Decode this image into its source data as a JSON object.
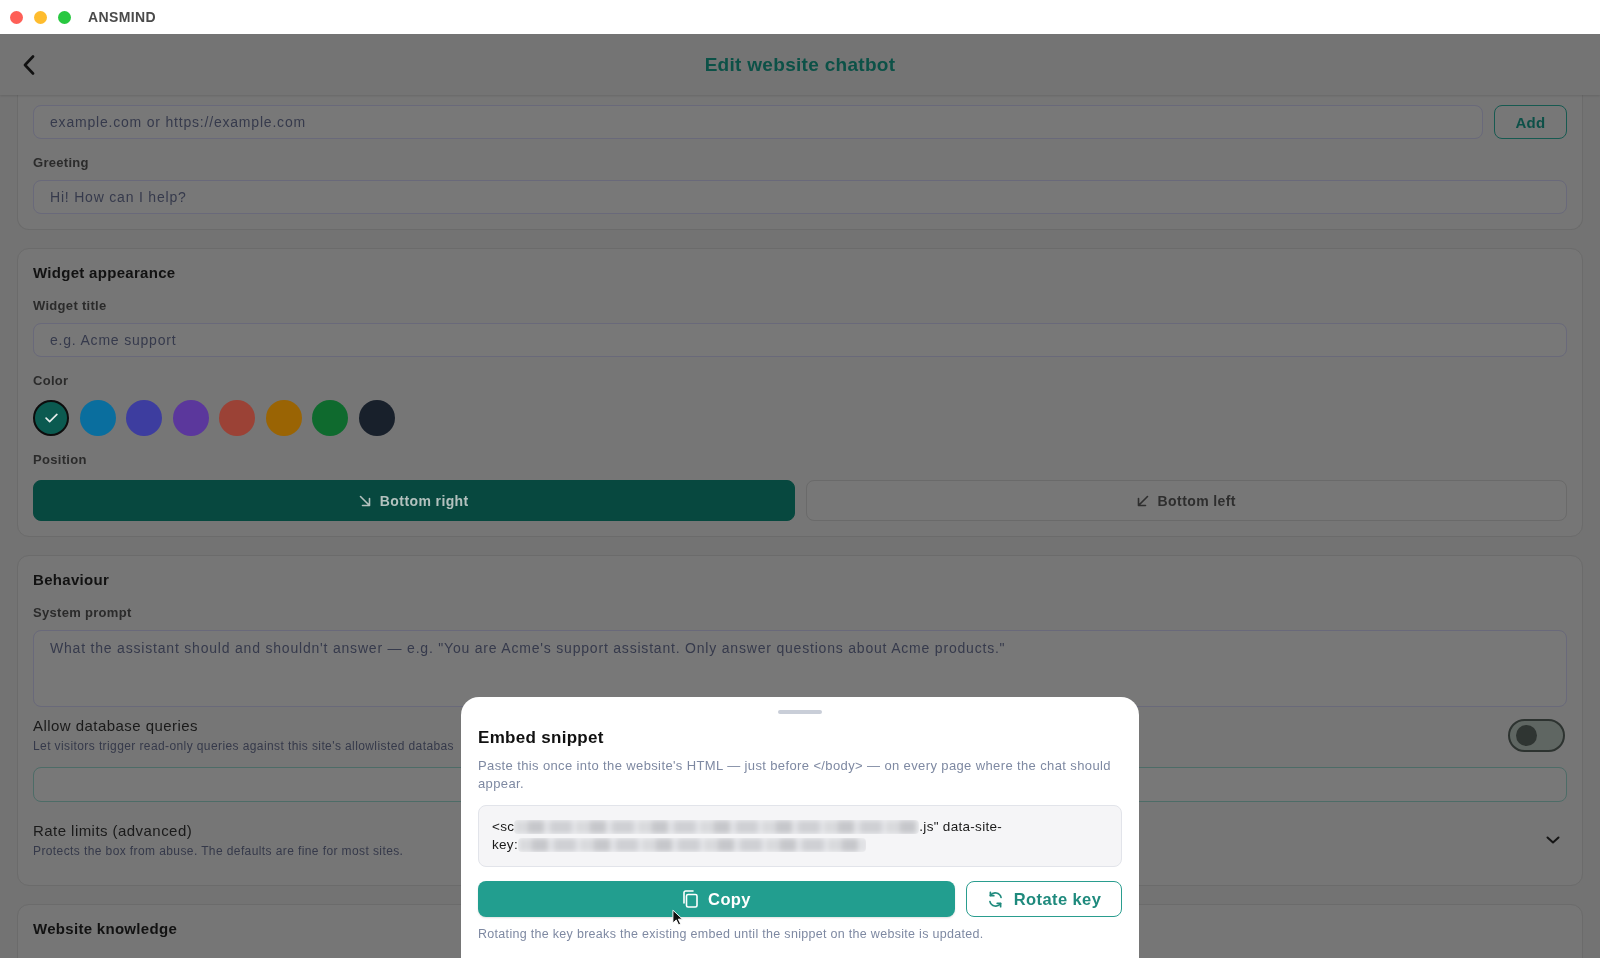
{
  "window": {
    "title": "ANSMIND"
  },
  "header": {
    "title": "Edit website chatbot"
  },
  "domains": {
    "placeholder": "example.com or https://example.com",
    "add_button": "Add"
  },
  "greeting": {
    "label": "Greeting",
    "placeholder": "Hi! How can I help?"
  },
  "widget_appearance": {
    "heading": "Widget appearance",
    "title_field": {
      "label": "Widget title",
      "placeholder": "e.g. Acme support"
    },
    "color_label": "Color",
    "colors": [
      {
        "color": "#0b5a50",
        "selected": true
      },
      {
        "color": "#0a6e9e",
        "selected": false
      },
      {
        "color": "#3d3d9f",
        "selected": false
      },
      {
        "color": "#5b379c",
        "selected": false
      },
      {
        "color": "#9b4236",
        "selected": false
      },
      {
        "color": "#9a6404",
        "selected": false
      },
      {
        "color": "#0f6a2e",
        "selected": false
      },
      {
        "color": "#18202b",
        "selected": false
      }
    ],
    "position_label": "Position",
    "positions": [
      {
        "kind": "right",
        "label": "Bottom right",
        "selected": true
      },
      {
        "kind": "left",
        "label": "Bottom left",
        "selected": false
      }
    ]
  },
  "behaviour": {
    "heading": "Behaviour",
    "system_prompt": {
      "label": "System prompt",
      "placeholder": "What the assistant should and shouldn't answer — e.g. \"You are Acme's support assistant. Only answer questions about Acme products.\""
    },
    "database_queries": {
      "label": "Allow database queries",
      "description": "Let visitors trigger read-only queries against this site's allowlisted databas",
      "on": false,
      "field": {
        "focused": true
      }
    },
    "rate_limits": {
      "label": "Rate limits (advanced)",
      "description": "Protects the box from abuse. The defaults are fine for most sites.",
      "expanded": false
    }
  },
  "website_knowledge": {
    "heading": "Website knowledge"
  },
  "embed_sheet": {
    "title": "Embed snippet",
    "description": "Paste this once into the website's HTML — just before </body> — on every page where the chat should appear.",
    "snippet": {
      "lines": [
        {
          "parts": [
            {
              "kind": "text",
              "text": "<sc"
            },
            {
              "kind": "redacted"
            },
            {
              "kind": "text",
              "text": ".js\" data-site-"
            }
          ]
        },
        {
          "parts": [
            {
              "kind": "text",
              "text": "key:"
            },
            {
              "kind": "redacted"
            }
          ]
        }
      ]
    },
    "copy_button": "Copy",
    "rotate_button": "Rotate key",
    "note": "Rotating the key breaks the existing embed until the snippet on the website is updated."
  }
}
